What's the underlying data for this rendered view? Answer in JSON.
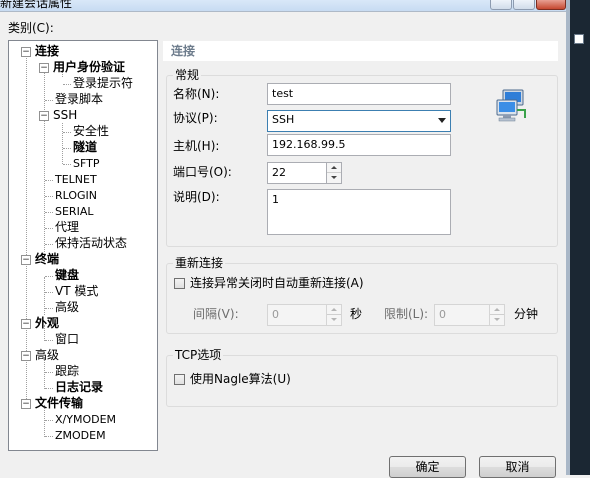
{
  "window": {
    "title": "新建会话属性"
  },
  "category_label": "类别(C):",
  "tree": {
    "connection": "连接",
    "auth": "用户身份验证",
    "login_prompts": "登录提示符",
    "login_script": "登录脚本",
    "ssh": "SSH",
    "security": "安全性",
    "tunneling": "隧道",
    "sftp": "SFTP",
    "telnet": "TELNET",
    "rlogin": "RLOGIN",
    "serial": "SERIAL",
    "proxy": "代理",
    "keepalive": "保持活动状态",
    "terminal": "终端",
    "keyboard": "键盘",
    "vt_mode": "VT 模式",
    "advanced_t": "高级",
    "appearance": "外观",
    "window": "窗口",
    "advanced": "高级",
    "tracing": "跟踪",
    "logging": "日志记录",
    "file_transfer": "文件传输",
    "xymodem": "X/YMODEM",
    "zmodem": "ZMODEM"
  },
  "panel": {
    "header": "连接",
    "general": {
      "title": "常规",
      "name_label": "名称(N):",
      "name_value": "test",
      "protocol_label": "协议(P):",
      "protocol_value": "SSH",
      "host_label": "主机(H):",
      "host_value": "192.168.99.5",
      "port_label": "端口号(O):",
      "port_value": "22",
      "desc_label": "说明(D):",
      "desc_value": "1"
    },
    "reconnect": {
      "title": "重新连接",
      "auto_label": "连接异常关闭时自动重新连接(A)",
      "auto_checked": false,
      "interval_label": "间隔(V):",
      "interval_value": "0",
      "sec_unit": "秒",
      "limit_label": "限制(L):",
      "limit_value": "0",
      "min_unit": "分钟"
    },
    "tcp": {
      "title": "TCP选项",
      "nagle_label": "使用Nagle算法(U)",
      "nagle_checked": false
    }
  },
  "buttons": {
    "ok": "确定",
    "cancel": "取消"
  },
  "icons": {
    "session": "network-computers-icon"
  }
}
